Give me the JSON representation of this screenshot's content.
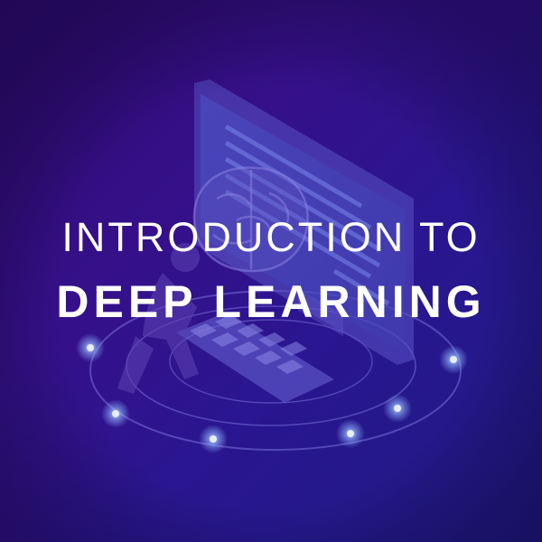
{
  "title": {
    "line1": "INTRODUCTION TO",
    "line2": "DEEP LEARNING"
  },
  "colors": {
    "background_start": "#2e0a6e",
    "background_end": "#1e1a86",
    "text": "#ffffff",
    "illustration": "#6a5fd0",
    "glow": "#8fb4ff"
  },
  "illustration": {
    "monitor": "monitor-icon",
    "keyboard": "keyboard-icon",
    "brain": "brain-icon",
    "person": "person-icon",
    "orbit_rings": "orbit-rings",
    "nodes": "glowing-node-icon"
  }
}
